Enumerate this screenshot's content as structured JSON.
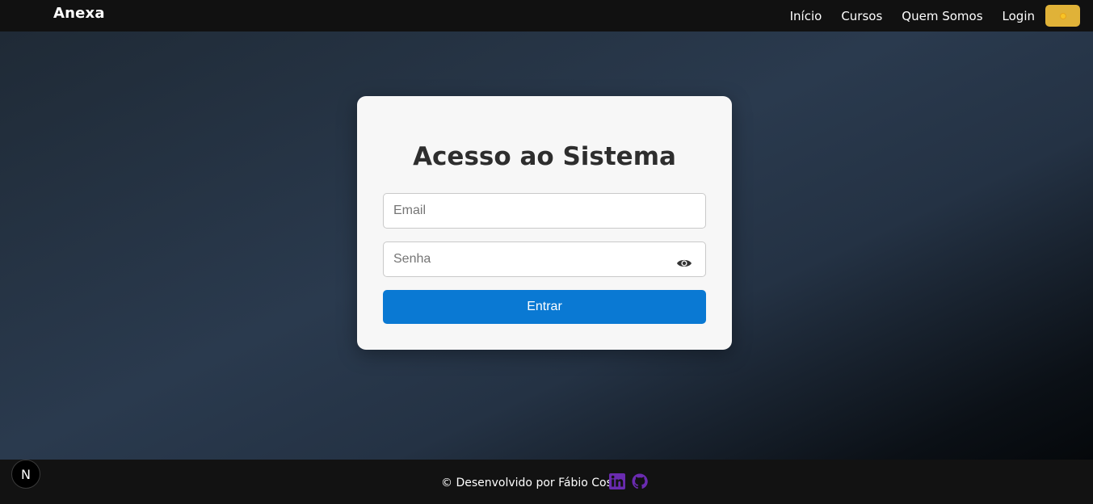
{
  "header": {
    "brand": "Anexa",
    "nav": [
      {
        "label": "Início"
      },
      {
        "label": "Cursos"
      },
      {
        "label": "Quem Somos"
      },
      {
        "label": "Login"
      }
    ],
    "theme_toggle_icon": "sun-icon"
  },
  "login": {
    "title": "Acesso ao Sistema",
    "email_placeholder": "Email",
    "email_value": "",
    "password_placeholder": "Senha",
    "password_value": "",
    "password_toggle_icon": "eye-icon",
    "submit_label": "Entrar"
  },
  "footer": {
    "text": "© Desenvolvido por Fábio Costa",
    "icons": [
      "linkedin-icon",
      "github-icon"
    ]
  },
  "dev_badge": {
    "label": "N"
  },
  "colors": {
    "header_bg": "#111111",
    "card_bg": "#f7f7f7",
    "button_bg": "#0a79d3",
    "social_icon": "#6a2bb0",
    "theme_toggle_bg": "#e0b238"
  }
}
